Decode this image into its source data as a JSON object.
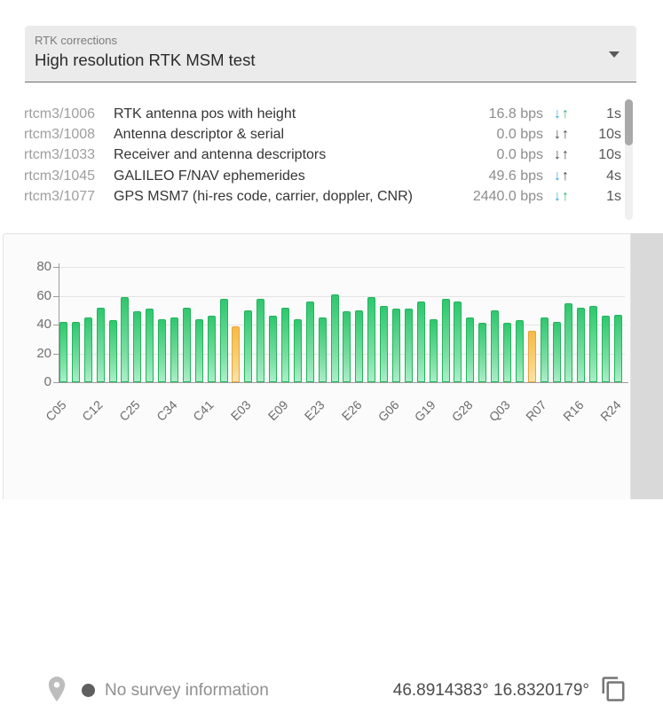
{
  "select": {
    "label": "RTK corrections",
    "value": "High resolution RTK MSM test"
  },
  "messages": {
    "down_arrow": "↓",
    "up_arrow": "↑",
    "rows": [
      {
        "id": "rtcm3/1006",
        "name": "RTK antenna pos with height",
        "rate": "16.8 bps",
        "interval": "1s",
        "down_active": true,
        "up_active": true
      },
      {
        "id": "rtcm3/1008",
        "name": "Antenna descriptor & serial",
        "rate": "0.0 bps",
        "interval": "10s",
        "down_active": false,
        "up_active": false
      },
      {
        "id": "rtcm3/1033",
        "name": "Receiver and antenna descriptors",
        "rate": "0.0 bps",
        "interval": "10s",
        "down_active": false,
        "up_active": false
      },
      {
        "id": "rtcm3/1045",
        "name": "GALILEO F/NAV ephemerides",
        "rate": "49.6 bps",
        "interval": "4s",
        "down_active": true,
        "up_active": false
      },
      {
        "id": "rtcm3/1077",
        "name": "GPS MSM7 (hi-res code, carrier, doppler, CNR)",
        "rate": "2440.0 bps",
        "interval": "1s",
        "down_active": true,
        "up_active": true
      }
    ]
  },
  "chart_data": {
    "type": "bar",
    "title": "",
    "xlabel": "",
    "ylabel": "",
    "ylim": [
      0,
      80
    ],
    "yticks": [
      0,
      20,
      40,
      60,
      80
    ],
    "grid": true,
    "values": [
      42,
      42,
      45,
      52,
      43,
      59,
      49,
      51,
      44,
      45,
      52,
      44,
      46,
      58,
      39,
      50,
      58,
      46,
      52,
      44,
      56,
      45,
      61,
      49,
      50,
      59,
      53,
      51,
      51,
      56,
      44,
      58,
      56,
      45,
      41,
      50,
      41,
      43,
      36,
      45,
      42,
      55,
      52,
      53,
      46,
      47
    ],
    "x_tick_labels": [
      "C05",
      "C12",
      "C25",
      "C34",
      "C41",
      "E03",
      "E09",
      "E23",
      "E26",
      "G06",
      "G19",
      "G28",
      "Q03",
      "R07",
      "R16",
      "R24"
    ],
    "label_every_n_bars": 3,
    "highlighted_bar_indices": [
      14,
      38
    ],
    "bar_color": "#2fc76e",
    "highlight_color": "#f6ba45"
  },
  "footer": {
    "status_text": "No survey information",
    "coordinates": "46.8914383° 16.8320179°"
  },
  "colors": {
    "arrow_down_active": "#3ba4dd",
    "arrow_up_active": "#2cb66c",
    "arrow_inactive": "#444444",
    "select_bg": "#ebebeb",
    "card_bg": "#fbfbfb",
    "right_strip": "#d9d9d9",
    "status_dot": "#5f5f5f"
  }
}
